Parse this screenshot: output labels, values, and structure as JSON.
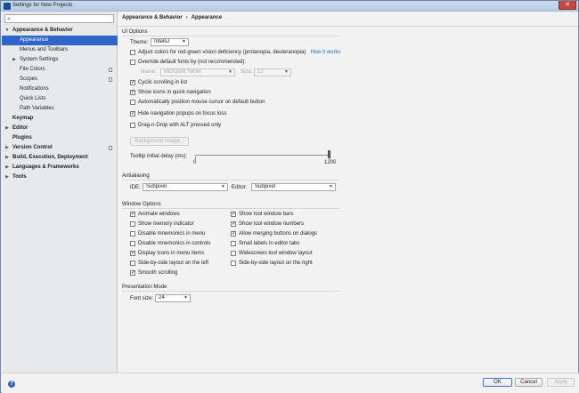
{
  "window": {
    "title": "Settings for New Projects",
    "close_glyph": "✕"
  },
  "search": {
    "placeholder": "",
    "icon": "search-icon"
  },
  "tree": [
    {
      "label": "Appearance & Behavior",
      "expanded": true,
      "bold": true
    },
    {
      "label": "Appearance",
      "selected": true
    },
    {
      "label": "Menus and Toolbars"
    },
    {
      "label": "System Settings",
      "collapsed": true
    },
    {
      "label": "File Colors",
      "project": true
    },
    {
      "label": "Scopes",
      "project": true
    },
    {
      "label": "Notifications"
    },
    {
      "label": "Quick Lists"
    },
    {
      "label": "Path Variables"
    },
    {
      "label": "Keymap",
      "bold": true
    },
    {
      "label": "Editor",
      "bold": true,
      "collapsed": true
    },
    {
      "label": "Plugins",
      "bold": true
    },
    {
      "label": "Version Control",
      "bold": true,
      "collapsed": true,
      "project": true
    },
    {
      "label": "Build, Execution, Deployment",
      "bold": true,
      "collapsed": true
    },
    {
      "label": "Languages & Frameworks",
      "bold": true,
      "collapsed": true
    },
    {
      "label": "Tools",
      "bold": true,
      "collapsed": true
    }
  ],
  "breadcrumb": {
    "parent": "Appearance & Behavior",
    "sep": "›",
    "current": "Appearance"
  },
  "ui_options": {
    "title": "UI Options",
    "theme_label": "Theme:",
    "theme_value": "IntelliJ",
    "adjust_colors": "Adjust colors for red-green vision deficiency (protanopia, deuteranopia)",
    "how_it_works": "How it works",
    "override_fonts": "Override default fonts by (not recommended):",
    "name_label": "Name:",
    "name_value": "Microsoft YaHei",
    "size_label": "Size:",
    "size_value": "12",
    "cyclic": "Cyclic scrolling in list",
    "show_icons": "Show icons in quick navigation",
    "auto_mouse": "Automatically position mouse cursor on default button",
    "hide_nav": "Hide navigation popups on focus loss",
    "drag_drop": "Drag-n-Drop with ALT pressed only",
    "bg_image": "Background Image...",
    "tooltip_label": "Tooltip initial delay (ms):",
    "tooltip_min": "0",
    "tooltip_max": "1200",
    "tooltip_value": 1200
  },
  "antialiasing": {
    "title": "Antialiasing",
    "ide_label": "IDE:",
    "ide_value": "Subpixel",
    "editor_label": "Editor:",
    "editor_value": "Subpixel"
  },
  "window_options": {
    "title": "Window Options",
    "left": [
      {
        "label": "Animate windows",
        "checked": true
      },
      {
        "label": "Show memory indicator",
        "checked": false
      },
      {
        "label": "Disable mnemonics in menu",
        "checked": false
      },
      {
        "label": "Disable mnemonics in controls",
        "checked": false
      },
      {
        "label": "Display icons in menu items",
        "checked": true
      },
      {
        "label": "Side-by-side layout on the left",
        "checked": false
      },
      {
        "label": "Smooth scrolling",
        "checked": true
      }
    ],
    "right": [
      {
        "label": "Show tool window bars",
        "checked": true
      },
      {
        "label": "Show tool window numbers",
        "checked": true
      },
      {
        "label": "Allow merging buttons on dialogs",
        "checked": true
      },
      {
        "label": "Small labels in editor tabs",
        "checked": false
      },
      {
        "label": "Widescreen tool window layout",
        "checked": false
      },
      {
        "label": "Side-by-side layout on the right",
        "checked": false
      }
    ]
  },
  "presentation": {
    "title": "Presentation Mode",
    "font_size_label": "Font size:",
    "font_size_value": "24"
  },
  "footer": {
    "help_glyph": "?",
    "ok": "OK",
    "cancel": "Cancel",
    "apply": "Apply"
  },
  "colors": {
    "selection": "#2f65ca",
    "link": "#2a6ac8",
    "close": "#c7463d"
  }
}
